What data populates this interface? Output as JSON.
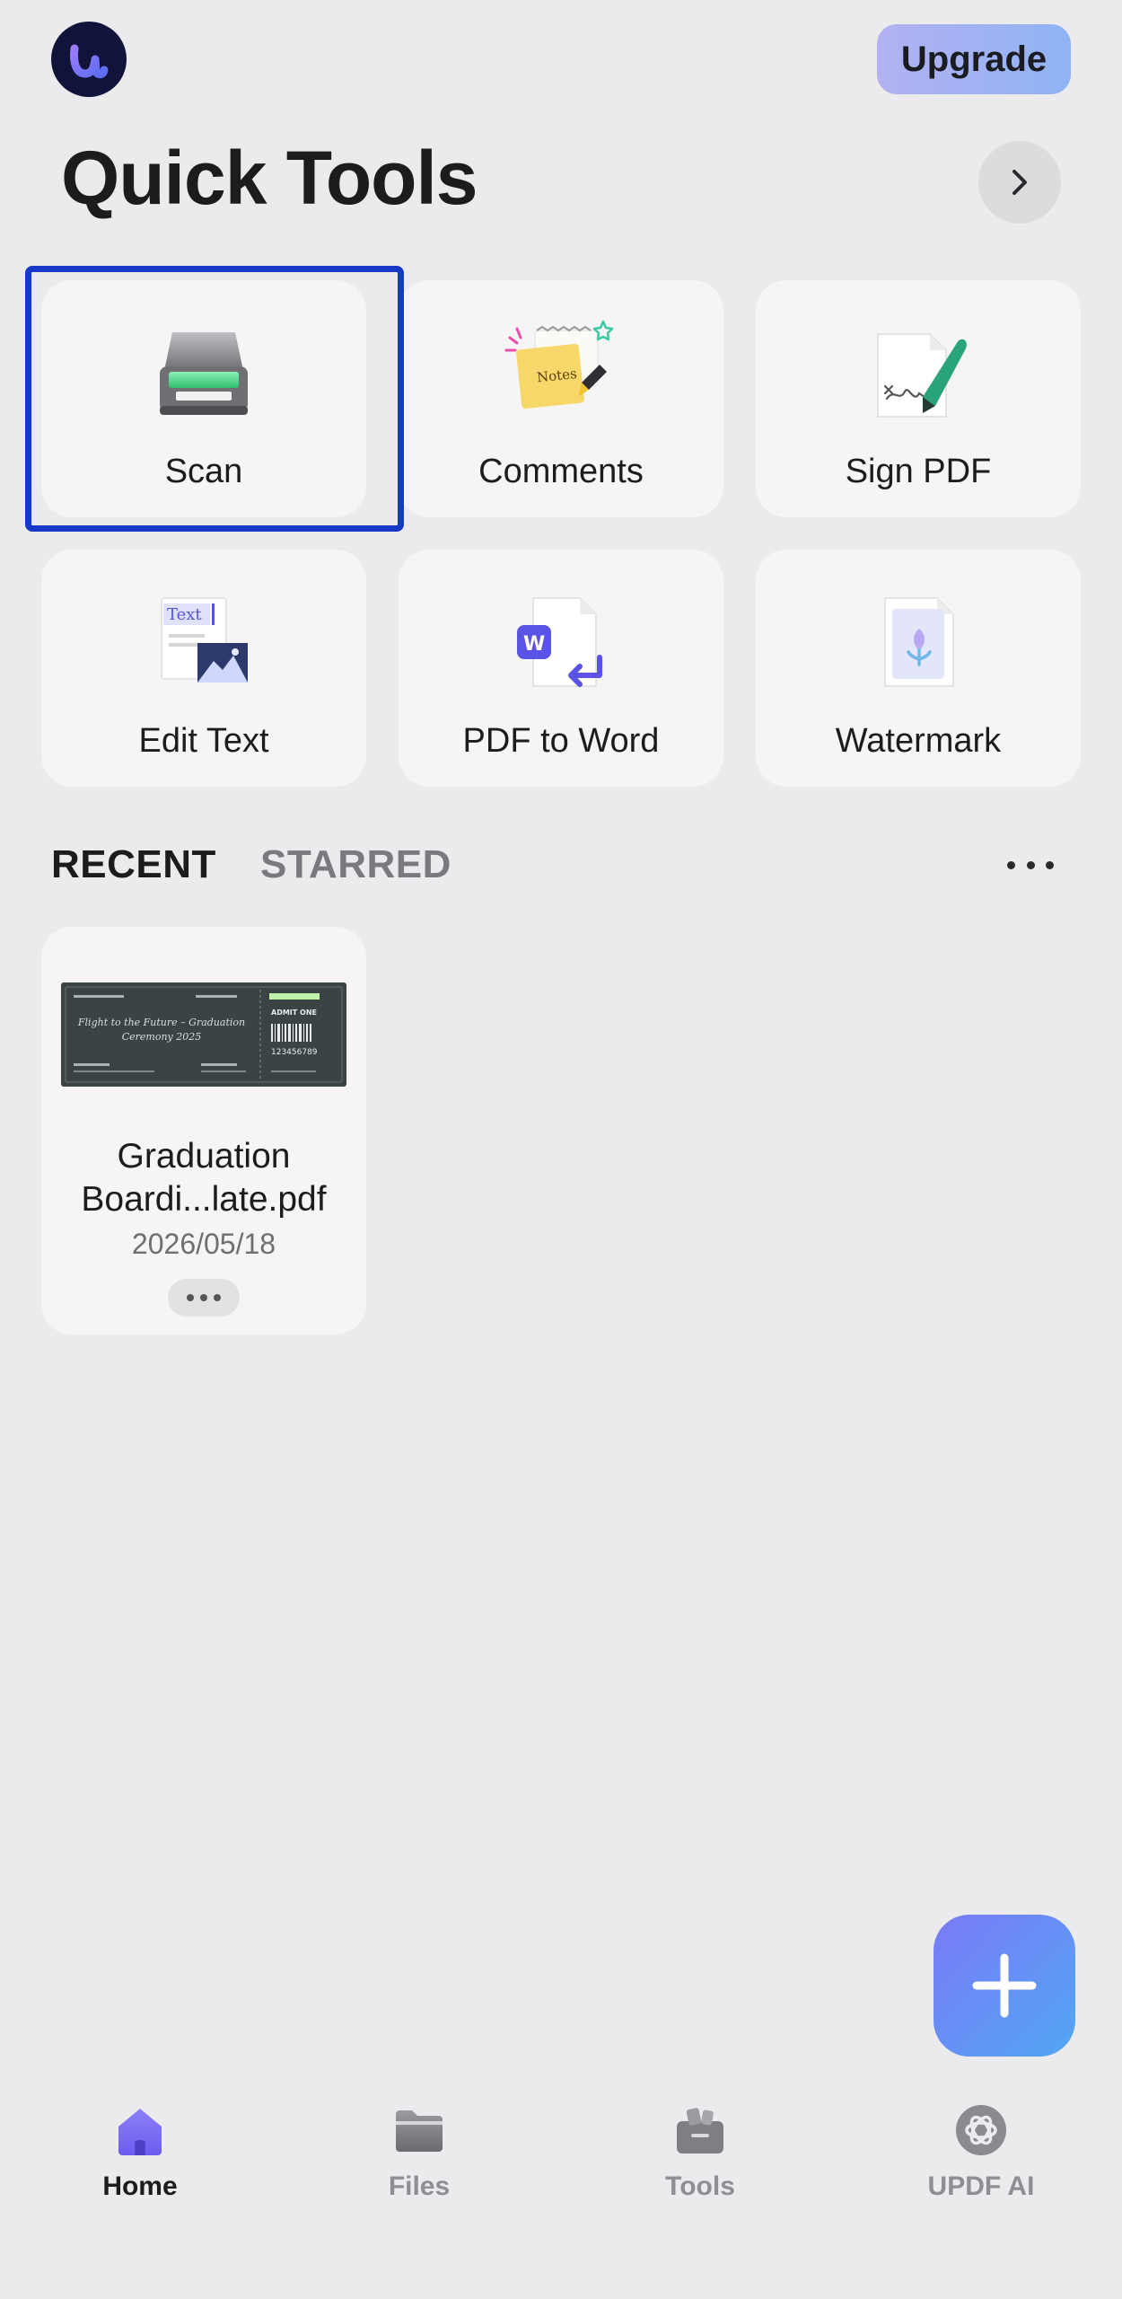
{
  "header": {
    "upgrade_label": "Upgrade",
    "title": "Quick Tools"
  },
  "tools": [
    {
      "label": "Scan",
      "icon": "scanner-icon"
    },
    {
      "label": "Comments",
      "icon": "notes-icon",
      "notes_text": "Notes"
    },
    {
      "label": "Sign PDF",
      "icon": "signature-pen-icon"
    },
    {
      "label": "Edit Text",
      "icon": "text-image-icon",
      "text_badge": "Text"
    },
    {
      "label": "PDF to Word",
      "icon": "word-convert-icon",
      "word_badge": "W"
    },
    {
      "label": "Watermark",
      "icon": "watermark-icon"
    }
  ],
  "sections": {
    "recent_label": "RECENT",
    "starred_label": "STARRED"
  },
  "recent_files": [
    {
      "name_line1": "Graduation",
      "name_line2": "Boardi...late.pdf",
      "date": "2026/05/18",
      "thumb_title_line1": "Flight to the Future – Graduation",
      "thumb_title_line2": "Ceremony 2025",
      "thumb_admit": "ADMIT ONE",
      "thumb_number": "123456789"
    }
  ],
  "nav": [
    {
      "label": "Home",
      "icon": "home-icon",
      "active": true
    },
    {
      "label": "Files",
      "icon": "folder-icon",
      "active": false
    },
    {
      "label": "Tools",
      "icon": "toolbox-icon",
      "active": false
    },
    {
      "label": "UPDF AI",
      "icon": "ai-icon",
      "active": false
    }
  ],
  "colors": {
    "background": "#ebebed",
    "focus_ring": "#1739c9",
    "accent": "#7a7af5",
    "card": "#f5f5f6"
  }
}
